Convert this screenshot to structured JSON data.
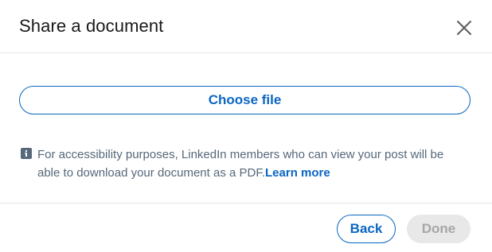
{
  "dialog": {
    "title": "Share a document",
    "close_icon": "close-icon"
  },
  "upload": {
    "choose_file_label": "Choose file"
  },
  "notice": {
    "icon": "info-icon",
    "text": "For accessibility purposes, LinkedIn members who can view your post will be able to download your document as a PDF.",
    "link_label": "Learn more"
  },
  "footer": {
    "back_label": "Back",
    "done_label": "Done",
    "done_disabled": true
  },
  "colors": {
    "accent": "#0a66c2",
    "text_primary": "#191919",
    "text_secondary": "#56687a",
    "disabled_bg": "#e8e8e8",
    "disabled_text": "#a6a6a6"
  }
}
